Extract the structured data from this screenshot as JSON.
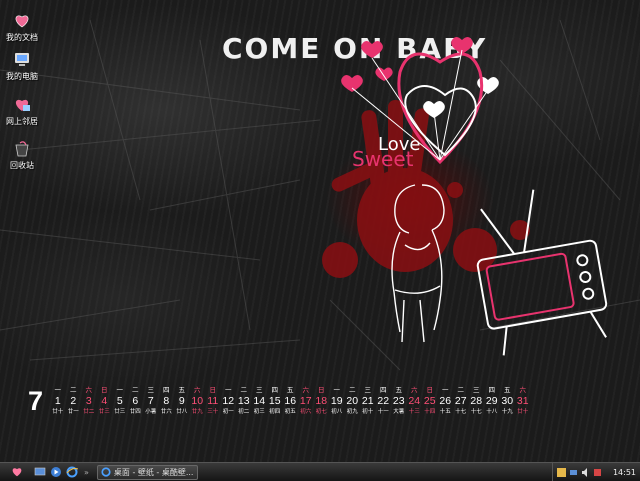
{
  "desktop_icons": [
    {
      "label": "我的文档",
      "icon": "heart-folder-icon"
    },
    {
      "label": "我的电脑",
      "icon": "computer-icon"
    },
    {
      "label": "网上邻居",
      "icon": "network-icon"
    },
    {
      "label": "回收站",
      "icon": "recycle-bin-icon"
    }
  ],
  "wallpaper": {
    "title_text": "COME ON BABY",
    "love_text": "Love",
    "sweet_text": "Sweet",
    "accent_color": "#e8336e",
    "blood_color": "#8a0f12"
  },
  "calendar": {
    "month": "7",
    "days": [
      {
        "wd": "一",
        "dn": "1",
        "lu": "廿十",
        "we": false
      },
      {
        "wd": "二",
        "dn": "2",
        "lu": "廿一",
        "we": false
      },
      {
        "wd": "六",
        "dn": "3",
        "lu": "廿二",
        "we": true
      },
      {
        "wd": "日",
        "dn": "4",
        "lu": "廿三",
        "we": true
      },
      {
        "wd": "一",
        "dn": "5",
        "lu": "廿三",
        "we": false
      },
      {
        "wd": "二",
        "dn": "6",
        "lu": "廿四",
        "we": false
      },
      {
        "wd": "三",
        "dn": "7",
        "lu": "小暑",
        "we": false
      },
      {
        "wd": "四",
        "dn": "8",
        "lu": "廿六",
        "we": false
      },
      {
        "wd": "五",
        "dn": "9",
        "lu": "廿八",
        "we": false
      },
      {
        "wd": "六",
        "dn": "10",
        "lu": "廿九",
        "we": true
      },
      {
        "wd": "日",
        "dn": "11",
        "lu": "三十",
        "we": true
      },
      {
        "wd": "一",
        "dn": "12",
        "lu": "初一",
        "we": false
      },
      {
        "wd": "二",
        "dn": "13",
        "lu": "初二",
        "we": false
      },
      {
        "wd": "三",
        "dn": "14",
        "lu": "初三",
        "we": false
      },
      {
        "wd": "四",
        "dn": "15",
        "lu": "初四",
        "we": false
      },
      {
        "wd": "五",
        "dn": "16",
        "lu": "初五",
        "we": false
      },
      {
        "wd": "六",
        "dn": "17",
        "lu": "初六",
        "we": true
      },
      {
        "wd": "日",
        "dn": "18",
        "lu": "初七",
        "we": true
      },
      {
        "wd": "一",
        "dn": "19",
        "lu": "初八",
        "we": false
      },
      {
        "wd": "二",
        "dn": "20",
        "lu": "初九",
        "we": false
      },
      {
        "wd": "三",
        "dn": "21",
        "lu": "初十",
        "we": false
      },
      {
        "wd": "四",
        "dn": "22",
        "lu": "十一",
        "we": false
      },
      {
        "wd": "五",
        "dn": "23",
        "lu": "大暑",
        "we": false
      },
      {
        "wd": "六",
        "dn": "24",
        "lu": "十三",
        "we": true
      },
      {
        "wd": "日",
        "dn": "25",
        "lu": "十四",
        "we": true
      },
      {
        "wd": "一",
        "dn": "26",
        "lu": "十五",
        "we": false
      },
      {
        "wd": "二",
        "dn": "27",
        "lu": "十七",
        "we": false
      },
      {
        "wd": "三",
        "dn": "28",
        "lu": "十七",
        "we": false
      },
      {
        "wd": "四",
        "dn": "29",
        "lu": "十八",
        "we": false
      },
      {
        "wd": "五",
        "dn": "30",
        "lu": "十九",
        "we": false
      },
      {
        "wd": "六",
        "dn": "31",
        "lu": "廿十",
        "we": true
      }
    ]
  },
  "taskbar": {
    "start_icon": "heart-icon",
    "quick_launch": [
      "show-desktop-icon",
      "media-player-icon",
      "ie-icon"
    ],
    "task_label": "桌面 - 壁纸 - 桌酷壁...",
    "clock": "14:51"
  }
}
